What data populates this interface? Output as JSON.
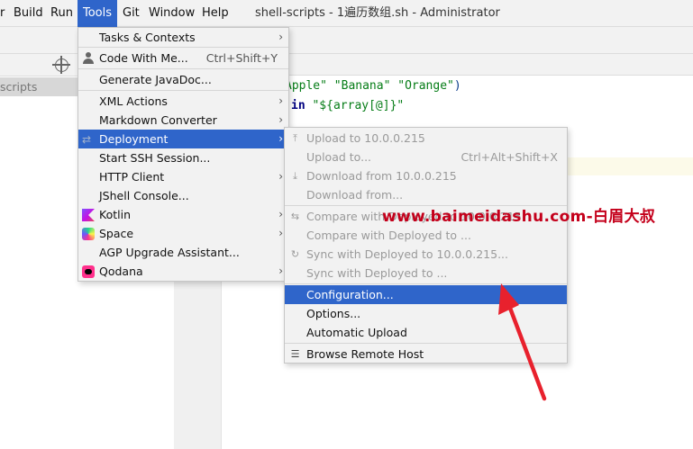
{
  "menubar": {
    "items": [
      "r",
      "Build",
      "Run",
      "Tools",
      "Git",
      "Window",
      "Help"
    ],
    "active": "Tools",
    "window_title": "shell-scripts - 1遍历数组.sh - Administrator"
  },
  "project": {
    "tree_row": "scripts"
  },
  "editor": {
    "line1": {
      "pre": "Apple\" ",
      "s2": "\"Banana\" ",
      "s3": "\"Orange\"",
      "post": ")"
    },
    "line2": {
      "kw": "in ",
      "rest": "\"${array[@]}\""
    }
  },
  "tools_menu": {
    "items": [
      {
        "label": "Tasks & Contexts",
        "submenu": true
      },
      {
        "label": "Code With Me...",
        "shortcut": "Ctrl+Shift+Y",
        "icon": "person-icon"
      },
      {
        "label": "Generate JavaDoc..."
      },
      {
        "label": "XML Actions",
        "submenu": true
      },
      {
        "label": "Markdown Converter",
        "submenu": true
      },
      {
        "label": "Deployment",
        "submenu": true,
        "selected": true,
        "icon": "deployment-icon"
      },
      {
        "label": "Start SSH Session..."
      },
      {
        "label": "HTTP Client",
        "submenu": true
      },
      {
        "label": "JShell Console..."
      },
      {
        "label": "Kotlin",
        "submenu": true,
        "icon": "kotlin-icon"
      },
      {
        "label": "Space",
        "submenu": true,
        "icon": "space-icon"
      },
      {
        "label": "AGP Upgrade Assistant..."
      },
      {
        "label": "Qodana",
        "submenu": true,
        "icon": "qodana-icon"
      }
    ],
    "arrow_glyph": "›"
  },
  "deployment_menu": {
    "items": [
      {
        "label": "Upload to 10.0.0.215",
        "disabled": true,
        "icon": "upload-icon"
      },
      {
        "label": "Upload to...",
        "shortcut": "Ctrl+Alt+Shift+X",
        "disabled": true
      },
      {
        "label": "Download from 10.0.0.215",
        "disabled": true,
        "icon": "download-icon"
      },
      {
        "label": "Download from...",
        "disabled": true
      },
      {
        "label": "Compare with Deployed to 10.0.0.215",
        "disabled": true,
        "icon": "compare-icon"
      },
      {
        "label": "Compare with Deployed to ...",
        "disabled": true
      },
      {
        "label": "Sync with Deployed to 10.0.0.215...",
        "disabled": true,
        "icon": "sync-icon"
      },
      {
        "label": "Sync with Deployed to ...",
        "disabled": true
      },
      {
        "label": "Configuration...",
        "selected": true
      },
      {
        "label": "Options..."
      },
      {
        "label": "Automatic Upload"
      },
      {
        "label": "Browse Remote Host",
        "icon": "browse-remote-host-icon"
      }
    ]
  },
  "watermark": "www.baimeidashu.com-白眉大叔",
  "colors": {
    "accent": "#2f65ca",
    "watermark": "#c4001b",
    "arrow": "#e8212d"
  }
}
